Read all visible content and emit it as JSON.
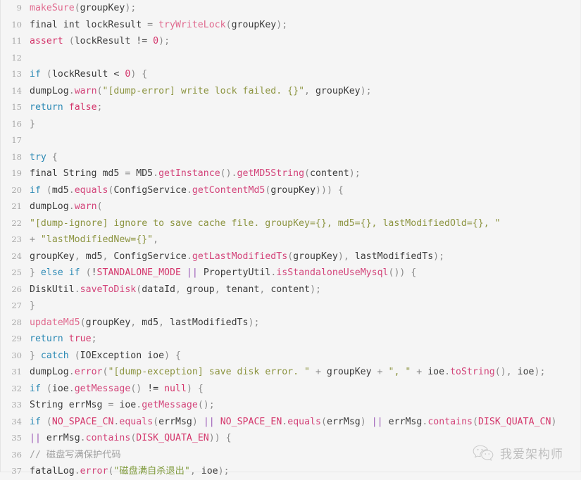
{
  "viewer": {
    "language": "java",
    "background_color": "#f5f5f5",
    "gutter_color": "#a8a8a8",
    "first_line_number": 9,
    "last_line_number": 37
  },
  "watermark": {
    "text": "我爱架构师",
    "icon": "wechat-icon"
  },
  "colors": {
    "keyword": "#2d8ab5",
    "keyword_literal": "#d4356b",
    "constant": "#d4356b",
    "method": "#d3447a",
    "function": "#e0698e",
    "string": "#8c9440",
    "operator": "#9b59b6",
    "comment": "#a0a0a0",
    "text": "#3b3b3b"
  },
  "lines": [
    {
      "n": "9",
      "plain": "makeSure(groupKey);",
      "tokens": [
        {
          "t": "makeSure",
          "c": "tok-fn"
        },
        {
          "t": "(",
          "c": "tok-punc"
        },
        {
          "t": "groupKey",
          "c": "tok-plain"
        },
        {
          "t": ")",
          "c": "tok-punc"
        },
        {
          "t": ";",
          "c": "tok-punc"
        }
      ]
    },
    {
      "n": "10",
      "plain": "final int lockResult = tryWriteLock(groupKey);",
      "tokens": [
        {
          "t": "final int lockResult ",
          "c": "tok-plain"
        },
        {
          "t": "= ",
          "c": "tok-punc"
        },
        {
          "t": "tryWriteLock",
          "c": "tok-fn"
        },
        {
          "t": "(",
          "c": "tok-punc"
        },
        {
          "t": "groupKey",
          "c": "tok-plain"
        },
        {
          "t": ")",
          "c": "tok-punc"
        },
        {
          "t": ";",
          "c": "tok-punc"
        }
      ]
    },
    {
      "n": "11",
      "plain": "assert (lockResult != 0);",
      "tokens": [
        {
          "t": "assert",
          "c": "tok-kw2"
        },
        {
          "t": " ",
          "c": "tok-plain"
        },
        {
          "t": "(",
          "c": "tok-punc"
        },
        {
          "t": "lockResult ",
          "c": "tok-plain"
        },
        {
          "t": "!= ",
          "c": "tok-plain"
        },
        {
          "t": "0",
          "c": "tok-kw2"
        },
        {
          "t": ")",
          "c": "tok-punc"
        },
        {
          "t": ";",
          "c": "tok-punc"
        }
      ]
    },
    {
      "n": "12",
      "plain": "",
      "tokens": []
    },
    {
      "n": "13",
      "plain": "if (lockResult < 0) {",
      "tokens": [
        {
          "t": "if",
          "c": "tok-kw"
        },
        {
          "t": " ",
          "c": "tok-plain"
        },
        {
          "t": "(",
          "c": "tok-punc"
        },
        {
          "t": "lockResult ",
          "c": "tok-plain"
        },
        {
          "t": "< ",
          "c": "tok-plain"
        },
        {
          "t": "0",
          "c": "tok-kw2"
        },
        {
          "t": ")",
          "c": "tok-punc"
        },
        {
          "t": " ",
          "c": "tok-plain"
        },
        {
          "t": "{",
          "c": "tok-punc"
        }
      ]
    },
    {
      "n": "14",
      "plain": "dumpLog.warn(\"[dump-error] write lock failed. {}\", groupKey);",
      "tokens": [
        {
          "t": "dumpLog",
          "c": "tok-plain"
        },
        {
          "t": ".",
          "c": "tok-punc"
        },
        {
          "t": "warn",
          "c": "tok-meth"
        },
        {
          "t": "(",
          "c": "tok-punc"
        },
        {
          "t": "\"[dump-error] write lock failed. {}\"",
          "c": "tok-str"
        },
        {
          "t": ", ",
          "c": "tok-punc"
        },
        {
          "t": "groupKey",
          "c": "tok-plain"
        },
        {
          "t": ")",
          "c": "tok-punc"
        },
        {
          "t": ";",
          "c": "tok-punc"
        }
      ]
    },
    {
      "n": "15",
      "plain": "return false;",
      "tokens": [
        {
          "t": "return",
          "c": "tok-kw"
        },
        {
          "t": " ",
          "c": "tok-plain"
        },
        {
          "t": "false",
          "c": "tok-kw2"
        },
        {
          "t": ";",
          "c": "tok-punc"
        }
      ]
    },
    {
      "n": "16",
      "plain": "}",
      "tokens": [
        {
          "t": "}",
          "c": "tok-punc"
        }
      ]
    },
    {
      "n": "17",
      "plain": "",
      "tokens": []
    },
    {
      "n": "18",
      "plain": "try {",
      "tokens": [
        {
          "t": "try",
          "c": "tok-kw"
        },
        {
          "t": " ",
          "c": "tok-plain"
        },
        {
          "t": "{",
          "c": "tok-punc"
        }
      ]
    },
    {
      "n": "19",
      "plain": "final String md5 = MD5.getInstance().getMD5String(content);",
      "tokens": [
        {
          "t": "final String md5 ",
          "c": "tok-plain"
        },
        {
          "t": "= ",
          "c": "tok-punc"
        },
        {
          "t": "MD5",
          "c": "tok-plain"
        },
        {
          "t": ".",
          "c": "tok-punc"
        },
        {
          "t": "getInstance",
          "c": "tok-meth"
        },
        {
          "t": "()",
          "c": "tok-punc"
        },
        {
          "t": ".",
          "c": "tok-punc"
        },
        {
          "t": "getMD5String",
          "c": "tok-meth"
        },
        {
          "t": "(",
          "c": "tok-punc"
        },
        {
          "t": "content",
          "c": "tok-plain"
        },
        {
          "t": ")",
          "c": "tok-punc"
        },
        {
          "t": ";",
          "c": "tok-punc"
        }
      ]
    },
    {
      "n": "20",
      "plain": "if (md5.equals(ConfigService.getContentMd5(groupKey))) {",
      "tokens": [
        {
          "t": "if",
          "c": "tok-kw"
        },
        {
          "t": " ",
          "c": "tok-plain"
        },
        {
          "t": "(",
          "c": "tok-punc"
        },
        {
          "t": "md5",
          "c": "tok-plain"
        },
        {
          "t": ".",
          "c": "tok-punc"
        },
        {
          "t": "equals",
          "c": "tok-meth"
        },
        {
          "t": "(",
          "c": "tok-punc"
        },
        {
          "t": "ConfigService",
          "c": "tok-plain"
        },
        {
          "t": ".",
          "c": "tok-punc"
        },
        {
          "t": "getContentMd5",
          "c": "tok-meth"
        },
        {
          "t": "(",
          "c": "tok-punc"
        },
        {
          "t": "groupKey",
          "c": "tok-plain"
        },
        {
          "t": ")))",
          "c": "tok-punc"
        },
        {
          "t": " ",
          "c": "tok-plain"
        },
        {
          "t": "{",
          "c": "tok-punc"
        }
      ]
    },
    {
      "n": "21",
      "plain": "dumpLog.warn(",
      "tokens": [
        {
          "t": "dumpLog",
          "c": "tok-plain"
        },
        {
          "t": ".",
          "c": "tok-punc"
        },
        {
          "t": "warn",
          "c": "tok-meth"
        },
        {
          "t": "(",
          "c": "tok-punc"
        }
      ]
    },
    {
      "n": "22",
      "plain": "\"[dump-ignore] ignore to save cache file. groupKey={}, md5={}, lastModifiedOld={}, \"",
      "tokens": [
        {
          "t": "\"[dump-ignore] ignore to save cache file. groupKey={}, md5={}, lastModifiedOld={}, \"",
          "c": "tok-str"
        }
      ]
    },
    {
      "n": "23",
      "plain": "+ \"lastModifiedNew={}\",",
      "tokens": [
        {
          "t": "+ ",
          "c": "tok-punc"
        },
        {
          "t": "\"lastModifiedNew={}\"",
          "c": "tok-str"
        },
        {
          "t": ",",
          "c": "tok-punc"
        }
      ]
    },
    {
      "n": "24",
      "plain": "groupKey, md5, ConfigService.getLastModifiedTs(groupKey), lastModifiedTs);",
      "tokens": [
        {
          "t": "groupKey",
          "c": "tok-plain"
        },
        {
          "t": ", ",
          "c": "tok-punc"
        },
        {
          "t": "md5",
          "c": "tok-plain"
        },
        {
          "t": ", ",
          "c": "tok-punc"
        },
        {
          "t": "ConfigService",
          "c": "tok-plain"
        },
        {
          "t": ".",
          "c": "tok-punc"
        },
        {
          "t": "getLastModifiedTs",
          "c": "tok-meth"
        },
        {
          "t": "(",
          "c": "tok-punc"
        },
        {
          "t": "groupKey",
          "c": "tok-plain"
        },
        {
          "t": ")",
          "c": "tok-punc"
        },
        {
          "t": ", ",
          "c": "tok-punc"
        },
        {
          "t": "lastModifiedTs",
          "c": "tok-plain"
        },
        {
          "t": ")",
          "c": "tok-punc"
        },
        {
          "t": ";",
          "c": "tok-punc"
        }
      ]
    },
    {
      "n": "25",
      "plain": "} else if (!STANDALONE_MODE || PropertyUtil.isStandaloneUseMysql()) {",
      "tokens": [
        {
          "t": "} ",
          "c": "tok-punc"
        },
        {
          "t": "else if",
          "c": "tok-kw"
        },
        {
          "t": " ",
          "c": "tok-plain"
        },
        {
          "t": "(",
          "c": "tok-punc"
        },
        {
          "t": "!",
          "c": "tok-plain"
        },
        {
          "t": "STANDALONE_MODE",
          "c": "tok-const"
        },
        {
          "t": " ",
          "c": "tok-plain"
        },
        {
          "t": "||",
          "c": "tok-op"
        },
        {
          "t": " ",
          "c": "tok-plain"
        },
        {
          "t": "PropertyUtil",
          "c": "tok-plain"
        },
        {
          "t": ".",
          "c": "tok-punc"
        },
        {
          "t": "isStandaloneUseMysql",
          "c": "tok-meth"
        },
        {
          "t": "())",
          "c": "tok-punc"
        },
        {
          "t": " ",
          "c": "tok-plain"
        },
        {
          "t": "{",
          "c": "tok-punc"
        }
      ]
    },
    {
      "n": "26",
      "plain": "DiskUtil.saveToDisk(dataId, group, tenant, content);",
      "tokens": [
        {
          "t": "DiskUtil",
          "c": "tok-plain"
        },
        {
          "t": ".",
          "c": "tok-punc"
        },
        {
          "t": "saveToDisk",
          "c": "tok-meth"
        },
        {
          "t": "(",
          "c": "tok-punc"
        },
        {
          "t": "dataId",
          "c": "tok-plain"
        },
        {
          "t": ", ",
          "c": "tok-punc"
        },
        {
          "t": "group",
          "c": "tok-plain"
        },
        {
          "t": ", ",
          "c": "tok-punc"
        },
        {
          "t": "tenant",
          "c": "tok-plain"
        },
        {
          "t": ", ",
          "c": "tok-punc"
        },
        {
          "t": "content",
          "c": "tok-plain"
        },
        {
          "t": ")",
          "c": "tok-punc"
        },
        {
          "t": ";",
          "c": "tok-punc"
        }
      ]
    },
    {
      "n": "27",
      "plain": "}",
      "tokens": [
        {
          "t": "}",
          "c": "tok-punc"
        }
      ]
    },
    {
      "n": "28",
      "plain": "updateMd5(groupKey, md5, lastModifiedTs);",
      "tokens": [
        {
          "t": "updateMd5",
          "c": "tok-fn"
        },
        {
          "t": "(",
          "c": "tok-punc"
        },
        {
          "t": "groupKey",
          "c": "tok-plain"
        },
        {
          "t": ", ",
          "c": "tok-punc"
        },
        {
          "t": "md5",
          "c": "tok-plain"
        },
        {
          "t": ", ",
          "c": "tok-punc"
        },
        {
          "t": "lastModifiedTs",
          "c": "tok-plain"
        },
        {
          "t": ")",
          "c": "tok-punc"
        },
        {
          "t": ";",
          "c": "tok-punc"
        }
      ]
    },
    {
      "n": "29",
      "plain": "return true;",
      "tokens": [
        {
          "t": "return",
          "c": "tok-kw"
        },
        {
          "t": " ",
          "c": "tok-plain"
        },
        {
          "t": "true",
          "c": "tok-kw2"
        },
        {
          "t": ";",
          "c": "tok-punc"
        }
      ]
    },
    {
      "n": "30",
      "plain": "} catch (IOException ioe) {",
      "tokens": [
        {
          "t": "} ",
          "c": "tok-punc"
        },
        {
          "t": "catch",
          "c": "tok-kw"
        },
        {
          "t": " ",
          "c": "tok-plain"
        },
        {
          "t": "(",
          "c": "tok-punc"
        },
        {
          "t": "IOException ioe",
          "c": "tok-plain"
        },
        {
          "t": ")",
          "c": "tok-punc"
        },
        {
          "t": " ",
          "c": "tok-plain"
        },
        {
          "t": "{",
          "c": "tok-punc"
        }
      ]
    },
    {
      "n": "31",
      "plain": "dumpLog.error(\"[dump-exception] save disk error. \" + groupKey + \", \" + ioe.toString(), ioe);",
      "tokens": [
        {
          "t": "dumpLog",
          "c": "tok-plain"
        },
        {
          "t": ".",
          "c": "tok-punc"
        },
        {
          "t": "error",
          "c": "tok-meth"
        },
        {
          "t": "(",
          "c": "tok-punc"
        },
        {
          "t": "\"[dump-exception] save disk error. \"",
          "c": "tok-str"
        },
        {
          "t": " + ",
          "c": "tok-punc"
        },
        {
          "t": "groupKey",
          "c": "tok-plain"
        },
        {
          "t": " + ",
          "c": "tok-punc"
        },
        {
          "t": "\", \"",
          "c": "tok-str"
        },
        {
          "t": " + ",
          "c": "tok-punc"
        },
        {
          "t": "ioe",
          "c": "tok-plain"
        },
        {
          "t": ".",
          "c": "tok-punc"
        },
        {
          "t": "toString",
          "c": "tok-meth"
        },
        {
          "t": "()",
          "c": "tok-punc"
        },
        {
          "t": ", ",
          "c": "tok-punc"
        },
        {
          "t": "ioe",
          "c": "tok-plain"
        },
        {
          "t": ")",
          "c": "tok-punc"
        },
        {
          "t": ";",
          "c": "tok-punc"
        }
      ]
    },
    {
      "n": "32",
      "plain": "if (ioe.getMessage() != null) {",
      "tokens": [
        {
          "t": "if",
          "c": "tok-kw"
        },
        {
          "t": " ",
          "c": "tok-plain"
        },
        {
          "t": "(",
          "c": "tok-punc"
        },
        {
          "t": "ioe",
          "c": "tok-plain"
        },
        {
          "t": ".",
          "c": "tok-punc"
        },
        {
          "t": "getMessage",
          "c": "tok-meth"
        },
        {
          "t": "()",
          "c": "tok-punc"
        },
        {
          "t": " != ",
          "c": "tok-plain"
        },
        {
          "t": "null",
          "c": "tok-kw2"
        },
        {
          "t": ")",
          "c": "tok-punc"
        },
        {
          "t": " ",
          "c": "tok-plain"
        },
        {
          "t": "{",
          "c": "tok-punc"
        }
      ]
    },
    {
      "n": "33",
      "plain": "String errMsg = ioe.getMessage();",
      "tokens": [
        {
          "t": "String errMsg ",
          "c": "tok-plain"
        },
        {
          "t": "= ",
          "c": "tok-punc"
        },
        {
          "t": "ioe",
          "c": "tok-plain"
        },
        {
          "t": ".",
          "c": "tok-punc"
        },
        {
          "t": "getMessage",
          "c": "tok-meth"
        },
        {
          "t": "()",
          "c": "tok-punc"
        },
        {
          "t": ";",
          "c": "tok-punc"
        }
      ]
    },
    {
      "n": "34",
      "plain": "if (NO_SPACE_CN.equals(errMsg) || NO_SPACE_EN.equals(errMsg) || errMsg.contains(DISK_QUATA_CN)",
      "tokens": [
        {
          "t": "if",
          "c": "tok-kw"
        },
        {
          "t": " ",
          "c": "tok-plain"
        },
        {
          "t": "(",
          "c": "tok-punc"
        },
        {
          "t": "NO_SPACE_CN",
          "c": "tok-const"
        },
        {
          "t": ".",
          "c": "tok-punc"
        },
        {
          "t": "equals",
          "c": "tok-meth"
        },
        {
          "t": "(",
          "c": "tok-punc"
        },
        {
          "t": "errMsg",
          "c": "tok-plain"
        },
        {
          "t": ")",
          "c": "tok-punc"
        },
        {
          "t": " ",
          "c": "tok-plain"
        },
        {
          "t": "||",
          "c": "tok-op"
        },
        {
          "t": " ",
          "c": "tok-plain"
        },
        {
          "t": "NO_SPACE_EN",
          "c": "tok-const"
        },
        {
          "t": ".",
          "c": "tok-punc"
        },
        {
          "t": "equals",
          "c": "tok-meth"
        },
        {
          "t": "(",
          "c": "tok-punc"
        },
        {
          "t": "errMsg",
          "c": "tok-plain"
        },
        {
          "t": ")",
          "c": "tok-punc"
        },
        {
          "t": " ",
          "c": "tok-plain"
        },
        {
          "t": "||",
          "c": "tok-op"
        },
        {
          "t": " ",
          "c": "tok-plain"
        },
        {
          "t": "errMsg",
          "c": "tok-plain"
        },
        {
          "t": ".",
          "c": "tok-punc"
        },
        {
          "t": "contains",
          "c": "tok-meth"
        },
        {
          "t": "(",
          "c": "tok-punc"
        },
        {
          "t": "DISK_QUATA_CN",
          "c": "tok-const"
        },
        {
          "t": ")",
          "c": "tok-punc"
        }
      ]
    },
    {
      "n": "35",
      "plain": "|| errMsg.contains(DISK_QUATA_EN)) {",
      "tokens": [
        {
          "t": "||",
          "c": "tok-op"
        },
        {
          "t": " ",
          "c": "tok-plain"
        },
        {
          "t": "errMsg",
          "c": "tok-plain"
        },
        {
          "t": ".",
          "c": "tok-punc"
        },
        {
          "t": "contains",
          "c": "tok-meth"
        },
        {
          "t": "(",
          "c": "tok-punc"
        },
        {
          "t": "DISK_QUATA_EN",
          "c": "tok-const"
        },
        {
          "t": "))",
          "c": "tok-punc"
        },
        {
          "t": " ",
          "c": "tok-plain"
        },
        {
          "t": "{",
          "c": "tok-punc"
        }
      ]
    },
    {
      "n": "36",
      "plain": "// 磁盘写满保护代码",
      "tokens": [
        {
          "t": "// 磁盘写满保护代码",
          "c": "tok-comment"
        }
      ]
    },
    {
      "n": "37",
      "plain": "fatalLog.error(\"磁盘满自杀退出\", ioe);",
      "tokens": [
        {
          "t": "fatalLog",
          "c": "tok-plain"
        },
        {
          "t": ".",
          "c": "tok-punc"
        },
        {
          "t": "error",
          "c": "tok-meth"
        },
        {
          "t": "(",
          "c": "tok-punc"
        },
        {
          "t": "\"磁盘满自杀退出\"",
          "c": "tok-strcn"
        },
        {
          "t": ", ",
          "c": "tok-punc"
        },
        {
          "t": "ioe",
          "c": "tok-plain"
        },
        {
          "t": ")",
          "c": "tok-punc"
        },
        {
          "t": ";",
          "c": "tok-punc"
        }
      ]
    }
  ]
}
